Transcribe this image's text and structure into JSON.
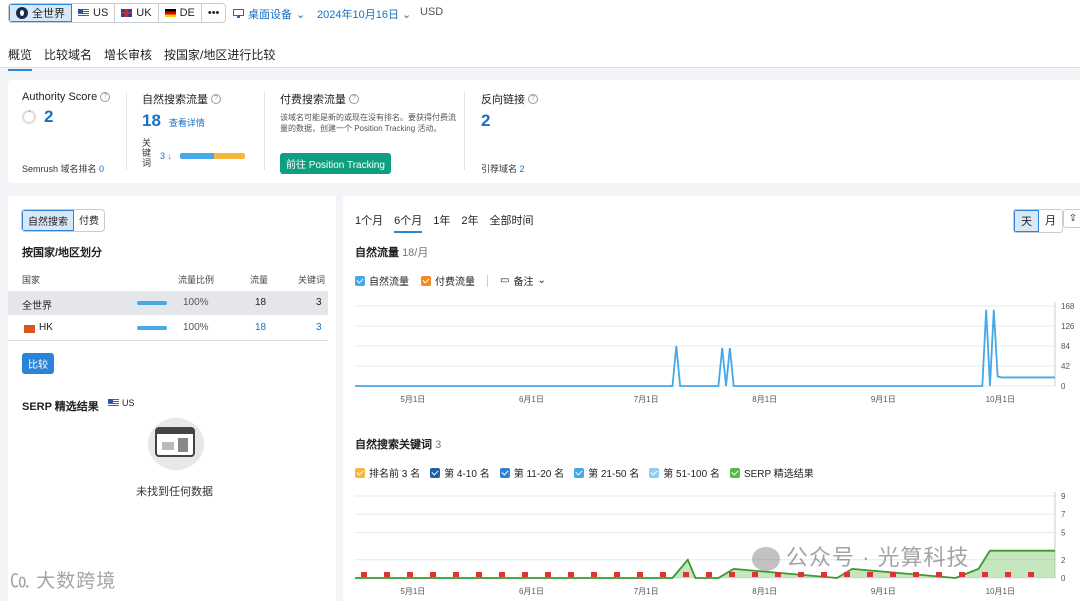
{
  "colors": {
    "accent": "#2b84d8",
    "link": "#1a6fc4",
    "green_button": "#0e9f80",
    "line_organic": "#45a8e8",
    "line_paid": "#f08a24"
  },
  "regions": [
    {
      "label": "全世界",
      "icon": "globe-icon"
    },
    {
      "label": "US",
      "icon": "flag-us-icon"
    },
    {
      "label": "UK",
      "icon": "flag-uk-icon"
    },
    {
      "label": "DE",
      "icon": "flag-de-icon"
    },
    {
      "label": "•••",
      "icon": "more-icon"
    }
  ],
  "toolbar": {
    "device": "桌面设备",
    "date": "2024年10月16日",
    "currency": "USD"
  },
  "tabs": [
    "概览",
    "比较域名",
    "增长审核",
    "按国家/地区进行比较"
  ],
  "metrics": {
    "authority": {
      "label": "Authority Score",
      "value": "2",
      "rank_label": "Semrush 域名排名",
      "rank_value": "0"
    },
    "organic": {
      "label": "自然搜索流量",
      "value": "18",
      "detail_link": "查看详情",
      "kw_label_1": "关",
      "kw_label_2": "键",
      "kw_label_3": "词",
      "kw_value": "3",
      "kw_arrow": "↓"
    },
    "paid": {
      "label": "付费搜索流量",
      "desc": "该域名可能是新的或现在没有排名。要获得付费流量的数据，创建一个 Position Tracking 活动。",
      "button": "前往 Position Tracking"
    },
    "backlinks": {
      "label": "反向链接",
      "value": "2",
      "ref_label": "引荐域名",
      "ref_value": "2"
    }
  },
  "left": {
    "seg": [
      "自然搜索",
      "付费"
    ],
    "country_title": "按国家/地区划分",
    "headers": [
      "国家",
      "流量比例",
      "流量",
      "关键词"
    ],
    "rows": [
      {
        "name": "全世界",
        "share": "100%",
        "traffic": "18",
        "keywords": "3",
        "share_fraction": 1.0
      },
      {
        "name": "HK",
        "share": "100%",
        "traffic": "18",
        "keywords": "3",
        "share_fraction": 1.0
      }
    ],
    "compare_button": "比较",
    "serp_title": "SERP 精选结果",
    "serp_region": "US",
    "no_data": "未找到任何数据"
  },
  "right": {
    "periods": [
      "1个月",
      "6个月",
      "1年",
      "2年",
      "全部时间"
    ],
    "active_period": "6个月",
    "granularity": [
      "天",
      "月"
    ],
    "traffic_title": "自然流量",
    "traffic_sub": "18/月",
    "legend1": [
      "自然流量",
      "付费流量"
    ],
    "notes": "备注",
    "kw_title": "自然搜索关键词",
    "kw_count": "3",
    "legend2": [
      {
        "label": "排名前 3 名",
        "color": "#f5b83d"
      },
      {
        "label": "第 4-10 名",
        "color": "#1f5fae"
      },
      {
        "label": "第 11-20 名",
        "color": "#2b84d8"
      },
      {
        "label": "第 21-50 名",
        "color": "#45a8e8"
      },
      {
        "label": "第 51-100 名",
        "color": "#8fcdf2"
      },
      {
        "label": "SERP 精选结果",
        "color": "#5bb84a"
      }
    ]
  },
  "chart_data": [
    {
      "type": "line",
      "title": "自然流量",
      "x_ticks": [
        "5月1日",
        "6月1日",
        "7月1日",
        "8月1日",
        "9月1日",
        "10月1日"
      ],
      "y_ticks": [
        "0",
        "42",
        "84",
        "126",
        "168"
      ],
      "ylim": [
        0,
        168
      ],
      "series": [
        {
          "name": "自然流量",
          "x": [
            "4月16日",
            "7月6日",
            "7月8日",
            "7月9日",
            "7月10日",
            "7月12日",
            "7月20日",
            "7月21日",
            "7月22日",
            "7月23日",
            "7月24日",
            "7月25日",
            "9月25日",
            "9月27日",
            "9月28日",
            "9月29日",
            "9月30日",
            "10月1日",
            "10月2日",
            "10月16日"
          ],
          "values": [
            0,
            0,
            0,
            84,
            0,
            0,
            0,
            80,
            0,
            80,
            0,
            0,
            0,
            0,
            160,
            0,
            160,
            20,
            18,
            18
          ]
        }
      ]
    },
    {
      "type": "area",
      "title": "自然搜索关键词",
      "x_ticks": [
        "5月1日",
        "6月1日",
        "7月1日",
        "8月1日",
        "9月1日",
        "10月1日"
      ],
      "y_ticks": [
        "0",
        "2",
        "5",
        "7",
        "9"
      ],
      "ylim": [
        0,
        9
      ],
      "series": [
        {
          "name": "SERP 精选结果",
          "x": [
            "4月16日",
            "7月8日",
            "7月12日",
            "7月14日",
            "7月20日",
            "7月24日",
            "8月20日",
            "8月24日",
            "9月20日",
            "9月26日",
            "9月29日",
            "10月2日",
            "10月16日"
          ],
          "values": [
            0,
            0,
            2,
            0,
            0,
            1,
            0,
            1,
            0,
            1,
            3,
            3,
            3
          ]
        }
      ]
    }
  ]
}
